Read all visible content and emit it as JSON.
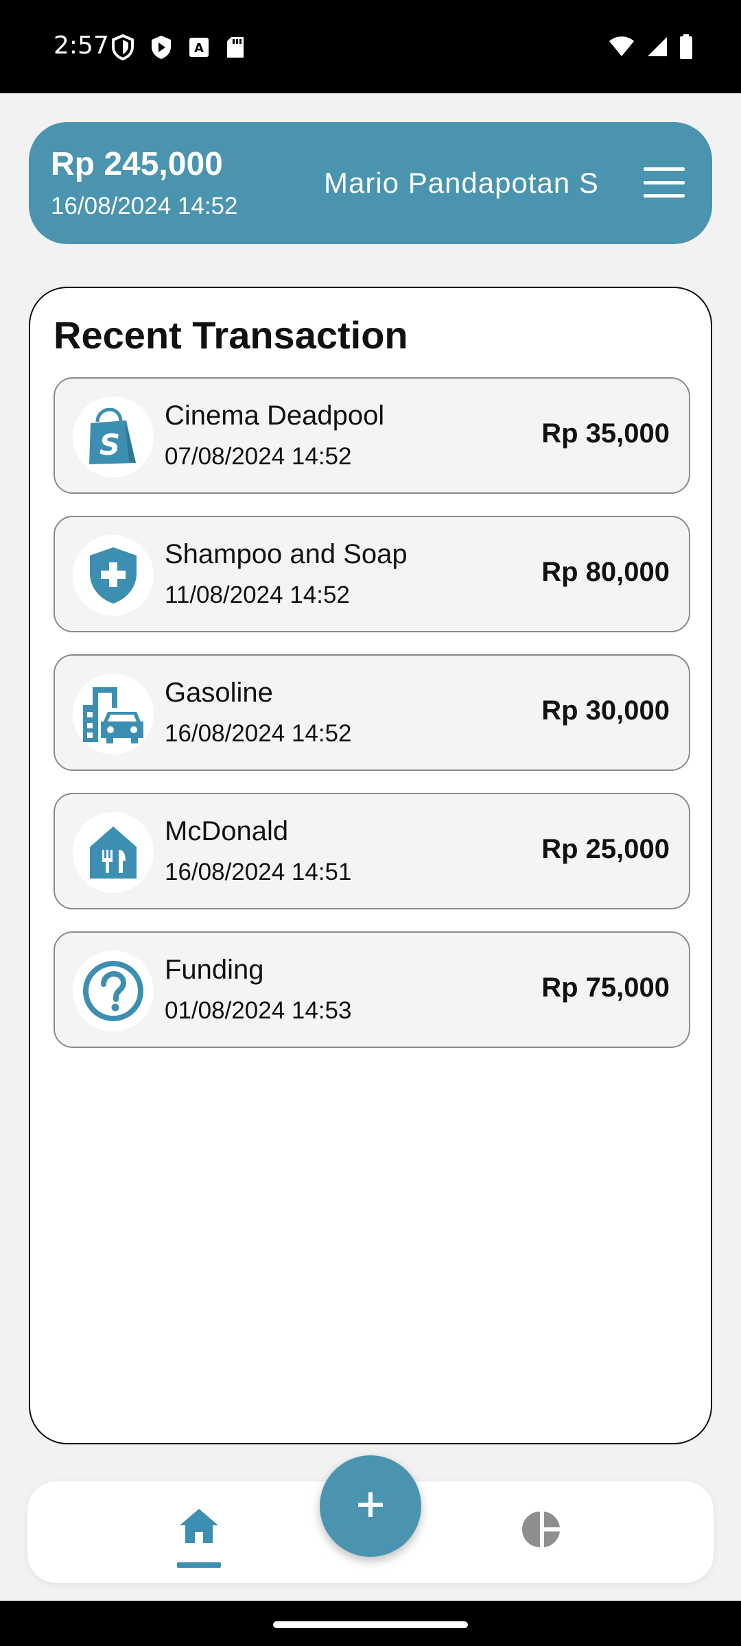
{
  "status_bar": {
    "time": "2:57"
  },
  "header": {
    "balance": "Rp 245,000",
    "datetime": "16/08/2024 14:52",
    "user_name": "Mario Pandapotan S"
  },
  "panel": {
    "title": "Recent Transaction"
  },
  "transactions": [
    {
      "name": "Cinema Deadpool",
      "date": "07/08/2024 14:52",
      "amount": "Rp 35,000",
      "icon": "shopping-bag-icon"
    },
    {
      "name": "Shampoo and Soap",
      "date": "11/08/2024 14:52",
      "amount": "Rp 80,000",
      "icon": "health-shield-icon"
    },
    {
      "name": "Gasoline",
      "date": "16/08/2024 14:52",
      "amount": "Rp 30,000",
      "icon": "city-car-icon"
    },
    {
      "name": "McDonald",
      "date": "16/08/2024 14:51",
      "amount": "Rp 25,000",
      "icon": "restaurant-icon"
    },
    {
      "name": "Funding",
      "date": "01/08/2024 14:53",
      "amount": "Rp 75,000",
      "icon": "help-icon"
    }
  ],
  "colors": {
    "accent": "#4a94b0",
    "background": "#f2f2f2",
    "card": "#f4f4f4"
  }
}
